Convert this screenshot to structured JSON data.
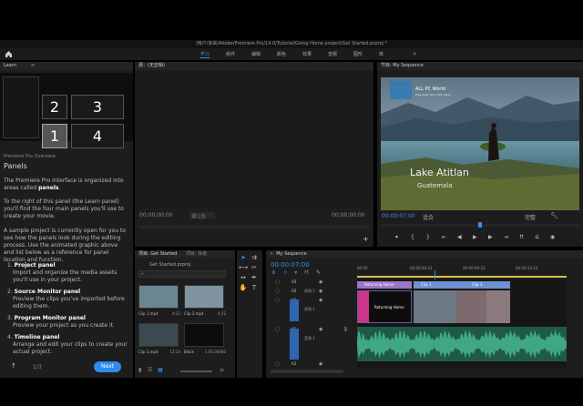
{
  "window": {
    "title": "/用户/未来/Adobe/Premiere Pro/14.0/Tutorial/Going Home project/Get Started.prproj *"
  },
  "workspaces": {
    "items": [
      "学习",
      "组件",
      "编辑",
      "颜色",
      "效果",
      "音频",
      "图形",
      "库"
    ],
    "active": 0,
    "more": "»"
  },
  "learn": {
    "tab": "Learn",
    "section": "Premiere Pro Overview",
    "heading": "Panels",
    "intro_pre": "The Premiere Pro interface is organized into areas called ",
    "intro_bold": "panels",
    "intro_post": ".",
    "para1": "To the right of this panel (the Learn panel) you'll find the four main panels you'll use to create your movie.",
    "para2": "A sample project is currently open for you to see how the panels look during the editing process. Use the animated graphic above and list below as a reference for panel location and function.",
    "list": [
      {
        "title": "Project panel",
        "desc": "Import and organize the media assets you'll use in your project."
      },
      {
        "title": "Source Monitor panel",
        "desc": "Preview the clips you've imported before editing them."
      },
      {
        "title": "Program Monitor panel",
        "desc": "Preview your project as you create it."
      },
      {
        "title": "Timeline panel",
        "desc": "Arrange and edit your clips to create your actual project."
      }
    ],
    "diagram_numbers": [
      "2",
      "3",
      "1",
      "4"
    ],
    "page": "1/3",
    "next": "Next"
  },
  "source": {
    "tab": "源：(无剪辑)",
    "tc_left": "00;00;00;00",
    "page_label": "第1页",
    "tc_right": "00;00;00;00"
  },
  "program": {
    "tab": "节目: My Sequence",
    "tc": "00:00:07:00",
    "fit": "适合",
    "full": "完整",
    "tc_end": "00:00:19:23",
    "watermark_brand": "ALL PC World",
    "watermark_sub": "Free Apps One Click Away",
    "title_line1": "Lake Atitlan",
    "title_line2": "Guatemala"
  },
  "project": {
    "tab1": "项目: Get Started",
    "tab2": "项目: 库者",
    "file": "Get Started.prproj",
    "search_placeholder": "",
    "clips": [
      {
        "name": "Clip 1.mp4",
        "dur": "4:22"
      },
      {
        "name": "Clip 2.mp4",
        "dur": "4:22"
      },
      {
        "name": "Clip 3.mp4",
        "dur": "12:14"
      },
      {
        "name": "Black",
        "dur": "1:01:00000"
      }
    ]
  },
  "timeline": {
    "tab": "My Sequence",
    "tc": "00:00:07:00",
    "ruler": [
      "00:00",
      "00:00:04:23",
      "00:00:09:23",
      "00:00:14:23"
    ],
    "tracks": [
      "V3",
      "V2",
      "V1",
      "A1",
      "A2"
    ],
    "track_labels": {
      "v2": "视频 2",
      "v1": "视频 1",
      "a1": "音频 1"
    },
    "clips": {
      "title": "Returning Home",
      "title2": "Returning Home",
      "c1": "Clip 1",
      "c3": "Clip 3"
    }
  },
  "colors": {
    "accent": "#2d8ceb",
    "tc_blue": "#3a8ee6",
    "clip_purple": "#9a77c6",
    "clip_blue": "#6f8fd1",
    "audio_green": "#3fa882",
    "ruler_yellow": "#d4c24a"
  }
}
